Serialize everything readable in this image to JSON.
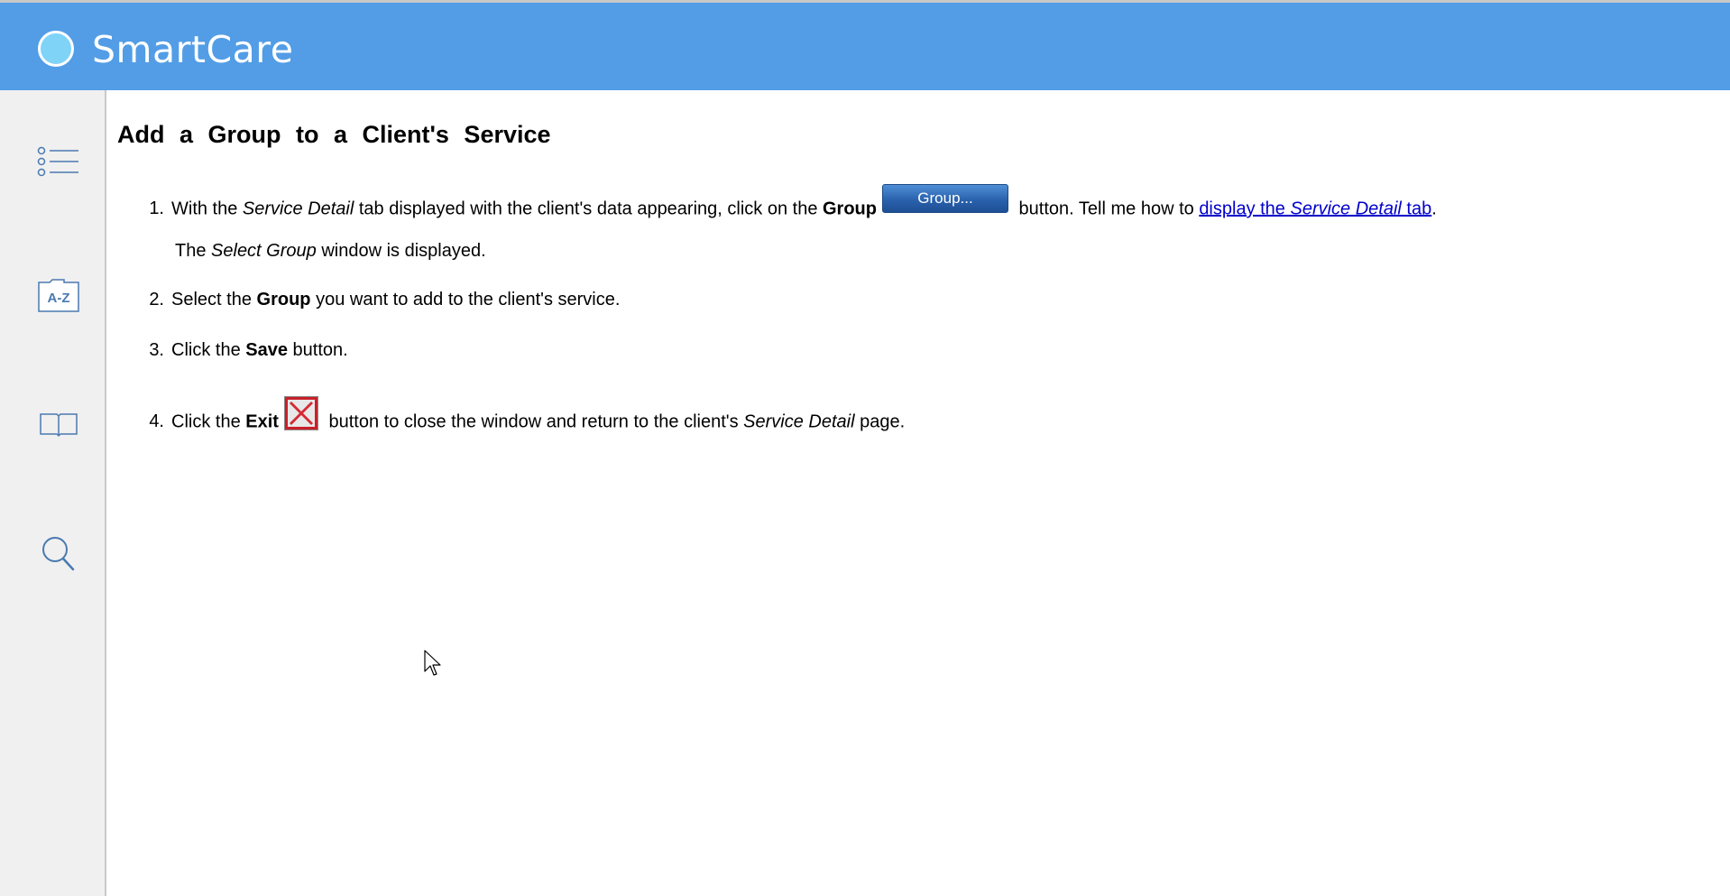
{
  "app": {
    "title": "SmartCare"
  },
  "sidebar": {
    "items": [
      {
        "name": "contents",
        "icon": "list-icon"
      },
      {
        "name": "index",
        "icon": "az-folder-icon",
        "label": "A-Z"
      },
      {
        "name": "glossary",
        "icon": "book-icon"
      },
      {
        "name": "search",
        "icon": "search-icon"
      }
    ]
  },
  "page": {
    "title": "Add a Group to a Client's Service",
    "step1": {
      "num": "1.",
      "t1": "With the ",
      "i1": "Service Detail",
      "t2": " tab displayed with the client's data appearing, click on the ",
      "b1": "Group",
      "button_label": "Group...",
      "t3": " button. Tell me how to ",
      "link_pre": "display the ",
      "link_italic": "Service Detail",
      "link_post": " tab",
      "t4": "."
    },
    "step1_result": {
      "t1": "The ",
      "i1": "Select Group",
      "t2": " window is displayed."
    },
    "step2": {
      "num": "2.",
      "t1": "Select the ",
      "b1": "Group",
      "t2": " you want to add to the client's service."
    },
    "step3": {
      "num": "3.",
      "t1": "Click the ",
      "b1": "Save",
      "t2": " button."
    },
    "step4": {
      "num": "4.",
      "t1": "Click the ",
      "b1": "Exit",
      "t2": " button to close the window and return to the client's ",
      "i1": "Service Detail",
      "t3": " page."
    }
  },
  "colors": {
    "header": "#529de6",
    "sidebar": "#f0f0f0",
    "icon": "#4a79b0",
    "link": "#0000cc"
  }
}
